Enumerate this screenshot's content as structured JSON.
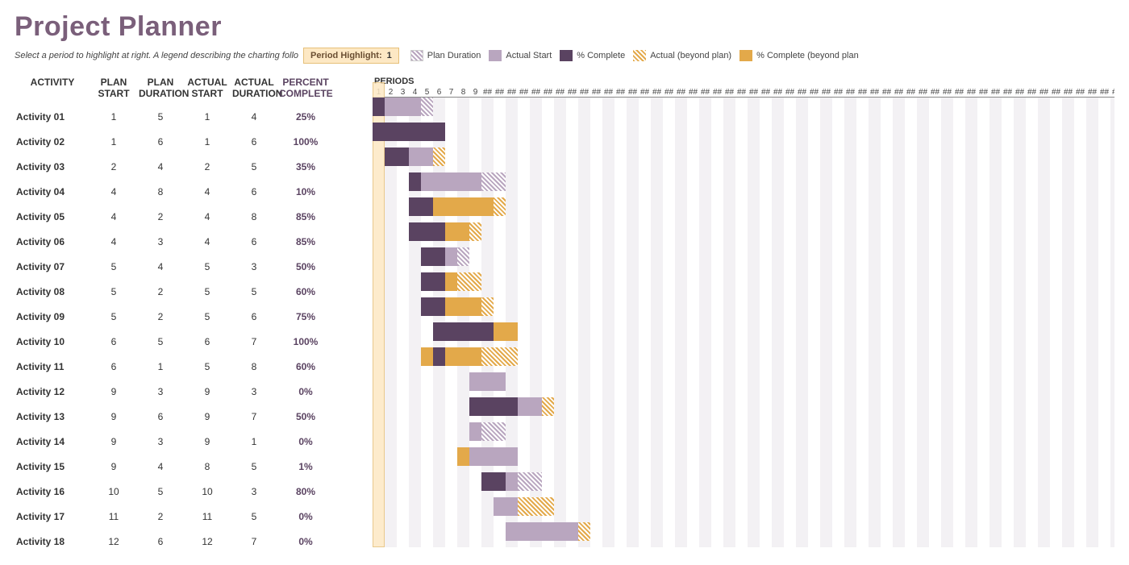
{
  "title": "Project Planner",
  "hint": "Select a period to highlight at right.  A legend describing the charting follo",
  "periodHighlightLabel": "Period Highlight:",
  "periodHighlightValue": 1,
  "legend": [
    {
      "label": "Plan Duration",
      "cls": "sw-plan"
    },
    {
      "label": "Actual Start",
      "cls": "sw-actual"
    },
    {
      "label": "% Complete",
      "cls": "sw-complete"
    },
    {
      "label": "Actual (beyond plan)",
      "cls": "sw-beyond"
    },
    {
      "label": "% Complete (beyond plan",
      "cls": "sw-compbeyond"
    }
  ],
  "headers": {
    "activity": "ACTIVITY",
    "planStart": "PLAN START",
    "planDur": "PLAN DURATION",
    "actStart": "ACTUAL START",
    "actDur": "ACTUAL DURATION",
    "pct": "PERCENT COMPLETE",
    "periods": "PERIODS"
  },
  "periodCount": 64,
  "labeledPeriods": 9,
  "cellWidth": 15,
  "chart_data": {
    "type": "gantt",
    "periods": 64,
    "highlight": 1,
    "activities": [
      {
        "name": "Activity 01",
        "planStart": 1,
        "planDur": 5,
        "actualStart": 1,
        "actualDur": 4,
        "pct": 25
      },
      {
        "name": "Activity 02",
        "planStart": 1,
        "planDur": 6,
        "actualStart": 1,
        "actualDur": 6,
        "pct": 100
      },
      {
        "name": "Activity 03",
        "planStart": 2,
        "planDur": 4,
        "actualStart": 2,
        "actualDur": 5,
        "pct": 35
      },
      {
        "name": "Activity 04",
        "planStart": 4,
        "planDur": 8,
        "actualStart": 4,
        "actualDur": 6,
        "pct": 10
      },
      {
        "name": "Activity 05",
        "planStart": 4,
        "planDur": 2,
        "actualStart": 4,
        "actualDur": 8,
        "pct": 85
      },
      {
        "name": "Activity 06",
        "planStart": 4,
        "planDur": 3,
        "actualStart": 4,
        "actualDur": 6,
        "pct": 85
      },
      {
        "name": "Activity 07",
        "planStart": 5,
        "planDur": 4,
        "actualStart": 5,
        "actualDur": 3,
        "pct": 50
      },
      {
        "name": "Activity 08",
        "planStart": 5,
        "planDur": 2,
        "actualStart": 5,
        "actualDur": 5,
        "pct": 60
      },
      {
        "name": "Activity 09",
        "planStart": 5,
        "planDur": 2,
        "actualStart": 5,
        "actualDur": 6,
        "pct": 75
      },
      {
        "name": "Activity 10",
        "planStart": 6,
        "planDur": 5,
        "actualStart": 6,
        "actualDur": 7,
        "pct": 100
      },
      {
        "name": "Activity 11",
        "planStart": 6,
        "planDur": 1,
        "actualStart": 5,
        "actualDur": 8,
        "pct": 60
      },
      {
        "name": "Activity 12",
        "planStart": 9,
        "planDur": 3,
        "actualStart": 9,
        "actualDur": 3,
        "pct": 0
      },
      {
        "name": "Activity 13",
        "planStart": 9,
        "planDur": 6,
        "actualStart": 9,
        "actualDur": 7,
        "pct": 50
      },
      {
        "name": "Activity 14",
        "planStart": 9,
        "planDur": 3,
        "actualStart": 9,
        "actualDur": 1,
        "pct": 0
      },
      {
        "name": "Activity 15",
        "planStart": 9,
        "planDur": 4,
        "actualStart": 8,
        "actualDur": 5,
        "pct": 1
      },
      {
        "name": "Activity 16",
        "planStart": 10,
        "planDur": 5,
        "actualStart": 10,
        "actualDur": 3,
        "pct": 80
      },
      {
        "name": "Activity 17",
        "planStart": 11,
        "planDur": 2,
        "actualStart": 11,
        "actualDur": 5,
        "pct": 0
      },
      {
        "name": "Activity 18",
        "planStart": 12,
        "planDur": 6,
        "actualStart": 12,
        "actualDur": 7,
        "pct": 0
      }
    ]
  }
}
